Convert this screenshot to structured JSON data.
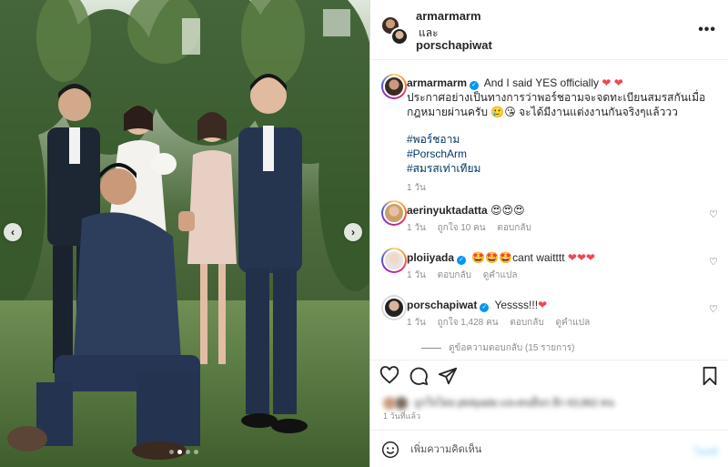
{
  "header": {
    "user1": "armarmarm",
    "and_text": "และ",
    "user2": "porschapiwat",
    "more_icon": "ellipsis-icon"
  },
  "caption": {
    "username": "armarmarm",
    "line1": "And I said YES officially",
    "hearts": "❤ ❤",
    "line2": "ประกาศอย่างเป็นทางการว่าพอร์ชอามจะจดทะเบียนสมรสกันเมื่อ",
    "line3": "กฎหมายผ่านครับ 🥲😘 จะได้มีงานแต่งงานกันจริงๆแล้ววว",
    "hashtags": [
      "#พอร์ชอาม",
      "#PorschArm",
      "#สมรสเท่าเทียม"
    ],
    "time": "1 วัน"
  },
  "comments": [
    {
      "username": "aerinyuktadatta",
      "text": "😍😍😍",
      "meta": [
        "1 วัน",
        "ถูกใจ 10 คน",
        "ตอบกลับ"
      ]
    },
    {
      "username": "ploiiyada",
      "text": "🤩🤩🤩cant waitttt",
      "hearts": "❤❤❤",
      "meta": [
        "1 วัน",
        "ตอบกลับ",
        "ดูคำแปล"
      ]
    },
    {
      "username": "porschapiwat",
      "text": "Yessss!!!",
      "hearts": "❤",
      "meta": [
        "1 วัน",
        "ถูกใจ 1,428 คน",
        "ตอบกลับ",
        "ดูคำแปล"
      ]
    }
  ],
  "view_replies": "ดูข้อความตอบกลับ (15 รายการ)",
  "likes_text": "ถูกใจโดย ploiiyada และคนอื่นๆ อีก 63,862 คน",
  "post_time": "1 วันที่แล้ว",
  "comment_box": {
    "placeholder": "เพิ่มความคิดเห็น",
    "post_label": "โพสต์"
  },
  "carousel": {
    "prev": "‹",
    "next": "›",
    "slide_count": 4,
    "active_slide": 2
  },
  "colors": {
    "heart": "#ed4956",
    "verified": "#0095f6",
    "hashtag": "#00376b",
    "post_disabled": "#b2dffc"
  }
}
